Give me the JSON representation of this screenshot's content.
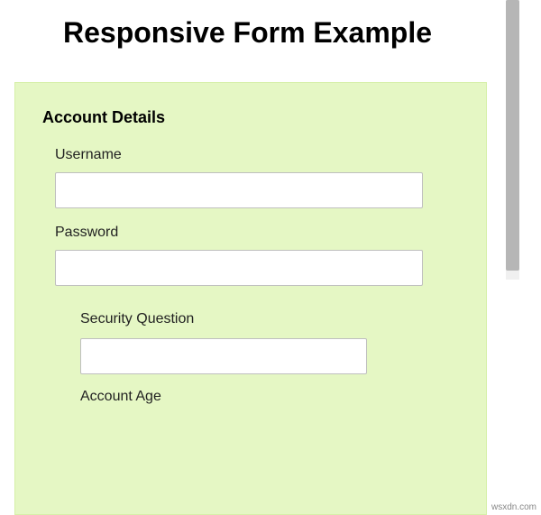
{
  "page": {
    "title": "Responsive Form Example"
  },
  "form": {
    "section_heading": "Account Details",
    "fields": {
      "username": {
        "label": "Username",
        "value": ""
      },
      "password": {
        "label": "Password",
        "value": ""
      },
      "security_question": {
        "label": "Security Question",
        "value": ""
      },
      "account_age": {
        "label": "Account Age"
      }
    }
  },
  "watermark": "wsxdn.com"
}
